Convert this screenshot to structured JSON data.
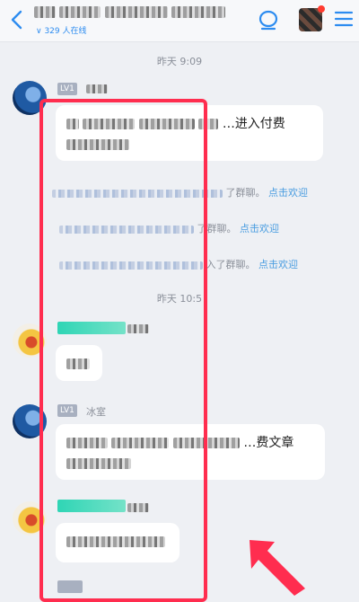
{
  "header": {
    "title": "中国课程经验经验、微素科",
    "online": "∨ 329 人在线"
  },
  "times": [
    "昨天 9:09",
    "昨天 10:5"
  ],
  "messages": [
    {
      "badge": "LV1",
      "name": "",
      "text": "…进入付费",
      "text2": ""
    },
    {
      "badge": "",
      "name": "",
      "text": "",
      "text2": ""
    },
    {
      "badge": "LV1",
      "name": "冰室",
      "text": "…费文章",
      "text2": ""
    },
    {
      "badge": "",
      "name": "",
      "text": "",
      "text2": ""
    }
  ],
  "system": [
    {
      "text": "了群聊。",
      "link": "点击欢迎"
    },
    {
      "text": "了群聊。",
      "link": "点击欢迎"
    },
    {
      "text": "入了群聊。",
      "link": "点击欢迎"
    }
  ],
  "colors": {
    "highlight_box": "#ff2d4f",
    "arrow": "#ff2d4f",
    "link": "#4a9de0"
  },
  "icons": [
    "back-icon",
    "chat-bubble-icon",
    "group-avatar",
    "menu-icon"
  ]
}
